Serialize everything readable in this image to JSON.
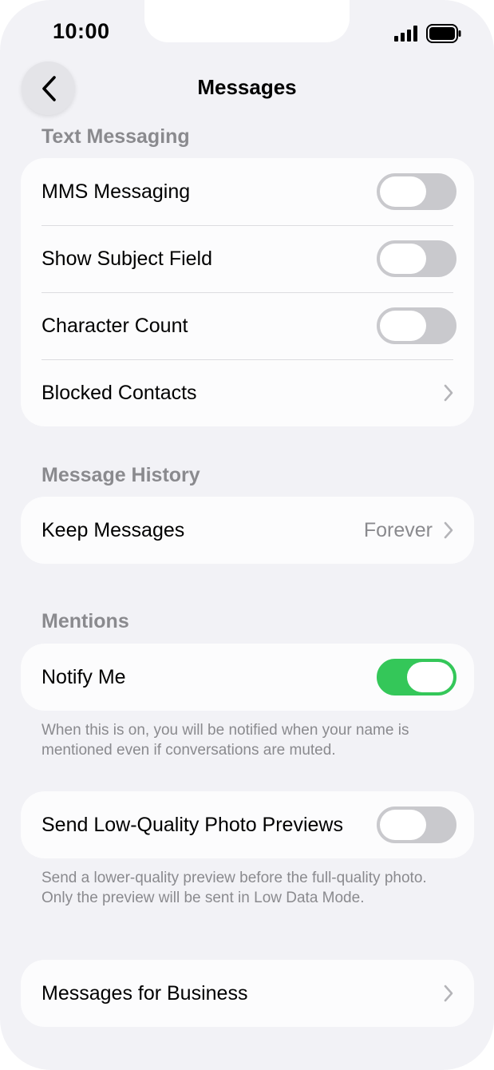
{
  "status_bar": {
    "time": "10:00"
  },
  "nav": {
    "title": "Messages"
  },
  "sections": {
    "text_messaging": {
      "header": "Text Messaging",
      "mms": {
        "label": "MMS Messaging",
        "on": false
      },
      "subject": {
        "label": "Show Subject Field",
        "on": false
      },
      "char_count": {
        "label": "Character Count",
        "on": false
      },
      "blocked": {
        "label": "Blocked Contacts"
      }
    },
    "history": {
      "header": "Message History",
      "keep": {
        "label": "Keep Messages",
        "value": "Forever"
      }
    },
    "mentions": {
      "header": "Mentions",
      "notify": {
        "label": "Notify Me",
        "on": true
      },
      "footnote": "When this is on, you will be notified when your name is mentioned even if conversations are muted."
    },
    "low_quality": {
      "label": "Send Low-Quality Photo Previews",
      "on": false,
      "footnote": "Send a lower-quality preview before the full-quality photo. Only the preview will be sent in Low Data Mode."
    },
    "business": {
      "label": "Messages for Business"
    }
  },
  "colors": {
    "background": "#f2f2f6",
    "cell": "#fcfcfd",
    "toggle_on": "#34c759",
    "toggle_off": "#c9c9cd",
    "secondary_text": "#8a8a8e"
  },
  "icons": [
    "back-chevron-icon",
    "signal-icon",
    "battery-icon",
    "chevron-right-icon"
  ]
}
